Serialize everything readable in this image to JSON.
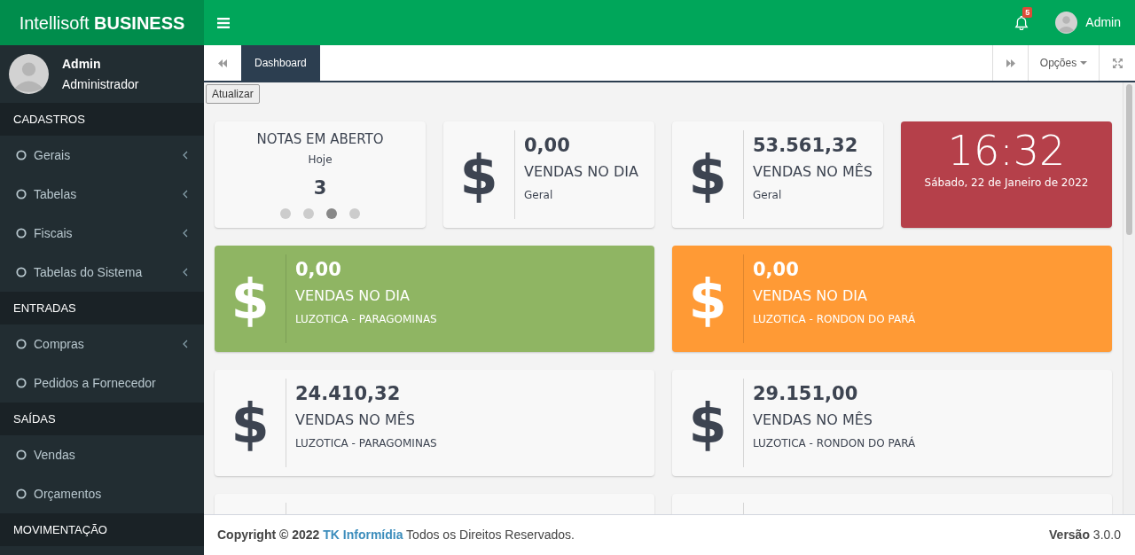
{
  "brand": "Intellisoft **BUSINESS**",
  "header": {
    "notifications": "5",
    "user": "Admin"
  },
  "sidebar": {
    "user": {
      "name": "Admin",
      "role": "Administrador"
    },
    "sections": [
      {
        "title": "CADASTROS",
        "items": [
          {
            "label": "Gerais",
            "has_submenu": true
          },
          {
            "label": "Tabelas",
            "has_submenu": true
          },
          {
            "label": "Fiscais",
            "has_submenu": true
          },
          {
            "label": "Tabelas do Sistema",
            "has_submenu": true
          }
        ]
      },
      {
        "title": "ENTRADAS",
        "items": [
          {
            "label": "Compras",
            "has_submenu": true
          },
          {
            "label": "Pedidos a Fornecedor",
            "has_submenu": false
          }
        ]
      },
      {
        "title": "SAÍDAS",
        "items": [
          {
            "label": "Vendas",
            "has_submenu": false
          },
          {
            "label": "Orçamentos",
            "has_submenu": false
          }
        ]
      },
      {
        "title": "MOVIMENTAÇÃO"
      }
    ]
  },
  "tabs": {
    "items": [
      {
        "label": "Dashboard",
        "selected": true
      }
    ],
    "options": "Opções"
  },
  "refresh_button": "Atualizar",
  "widget_rows": [
    [
      {
        "kind": "counter",
        "color": "#f8f8f8",
        "title": "NOTAS EM ABERTO",
        "subtitle": "Hoje",
        "value": "3",
        "dots": [
          {
            "selected": false
          },
          {
            "selected": false
          },
          {
            "selected": true
          },
          {
            "selected": false
          }
        ]
      },
      {
        "kind": "stat",
        "color": "#f8f8f8",
        "icon": "$",
        "value": "0,00",
        "label": "VENDAS NO DIA",
        "sub": "Geral"
      },
      {
        "kind": "stat",
        "color": "#f8f8f8",
        "icon": "$",
        "value": "53.561,32",
        "label": "VENDAS NO MÊS",
        "sub": "Geral"
      },
      {
        "kind": "clock",
        "color": "#b5404a",
        "time": "16:32",
        "date": "Sábado, 22 de Janeiro de 2022"
      }
    ],
    [
      {
        "kind": "stat",
        "color": "#8fb563",
        "icon": "$",
        "value": "0,00",
        "label": "VENDAS NO DIA",
        "sub": "LUZOTICA - PARAGOMINAS"
      },
      {
        "kind": "stat",
        "color": "#ff9a35",
        "icon": "$",
        "value": "0,00",
        "label": "VENDAS NO DIA",
        "sub": "LUZOTICA - RONDON DO PARÁ"
      }
    ],
    [
      {
        "kind": "stat",
        "color": "#f8f8f8",
        "icon": "$",
        "value": "24.410,32",
        "label": "VENDAS NO MÊS",
        "sub": "LUZOTICA - PARAGOMINAS"
      },
      {
        "kind": "stat",
        "color": "#f8f8f8",
        "icon": "$",
        "value": "29.151,00",
        "label": "VENDAS NO MÊS",
        "sub": "LUZOTICA - RONDON DO PARÁ"
      }
    ],
    [
      {
        "kind": "blank",
        "color": "#f8f8f8"
      },
      {
        "kind": "blank",
        "color": "#f8f8f8"
      }
    ]
  ],
  "footer": {
    "copyright": "Copyright © 2022",
    "company": "TK Informídia",
    "rights": "Todos os Direitos Reservados.",
    "version": "**Versão** 3.0.0"
  }
}
